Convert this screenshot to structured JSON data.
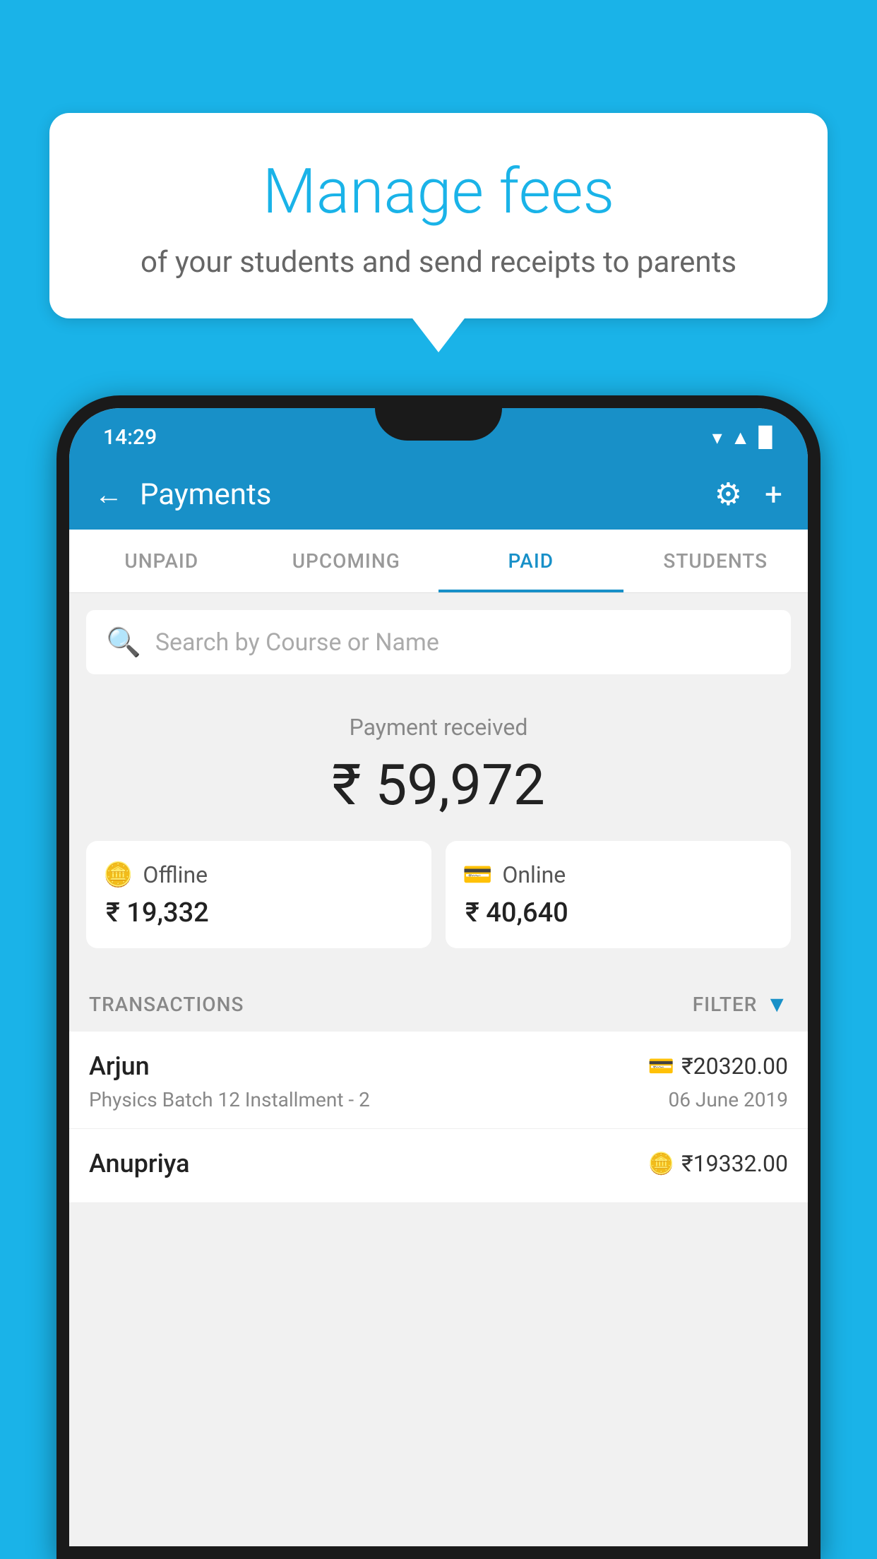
{
  "background_color": "#1ab3e8",
  "bubble": {
    "title": "Manage fees",
    "subtitle": "of your students and send receipts to parents"
  },
  "status_bar": {
    "time": "14:29"
  },
  "app_bar": {
    "title": "Payments",
    "back_label": "←",
    "settings_label": "⚙",
    "add_label": "+"
  },
  "tabs": [
    {
      "label": "UNPAID",
      "active": false
    },
    {
      "label": "UPCOMING",
      "active": false
    },
    {
      "label": "PAID",
      "active": true
    },
    {
      "label": "STUDENTS",
      "active": false
    }
  ],
  "search": {
    "placeholder": "Search by Course or Name"
  },
  "payment_received": {
    "label": "Payment received",
    "amount": "₹ 59,972",
    "offline": {
      "label": "Offline",
      "amount": "₹ 19,332"
    },
    "online": {
      "label": "Online",
      "amount": "₹ 40,640"
    }
  },
  "transactions": {
    "header": "TRANSACTIONS",
    "filter": "FILTER",
    "items": [
      {
        "name": "Arjun",
        "course": "Physics Batch 12 Installment - 2",
        "amount": "₹20320.00",
        "date": "06 June 2019",
        "payment_type": "card"
      },
      {
        "name": "Anupriya",
        "course": "",
        "amount": "₹19332.00",
        "date": "",
        "payment_type": "cash"
      }
    ]
  }
}
